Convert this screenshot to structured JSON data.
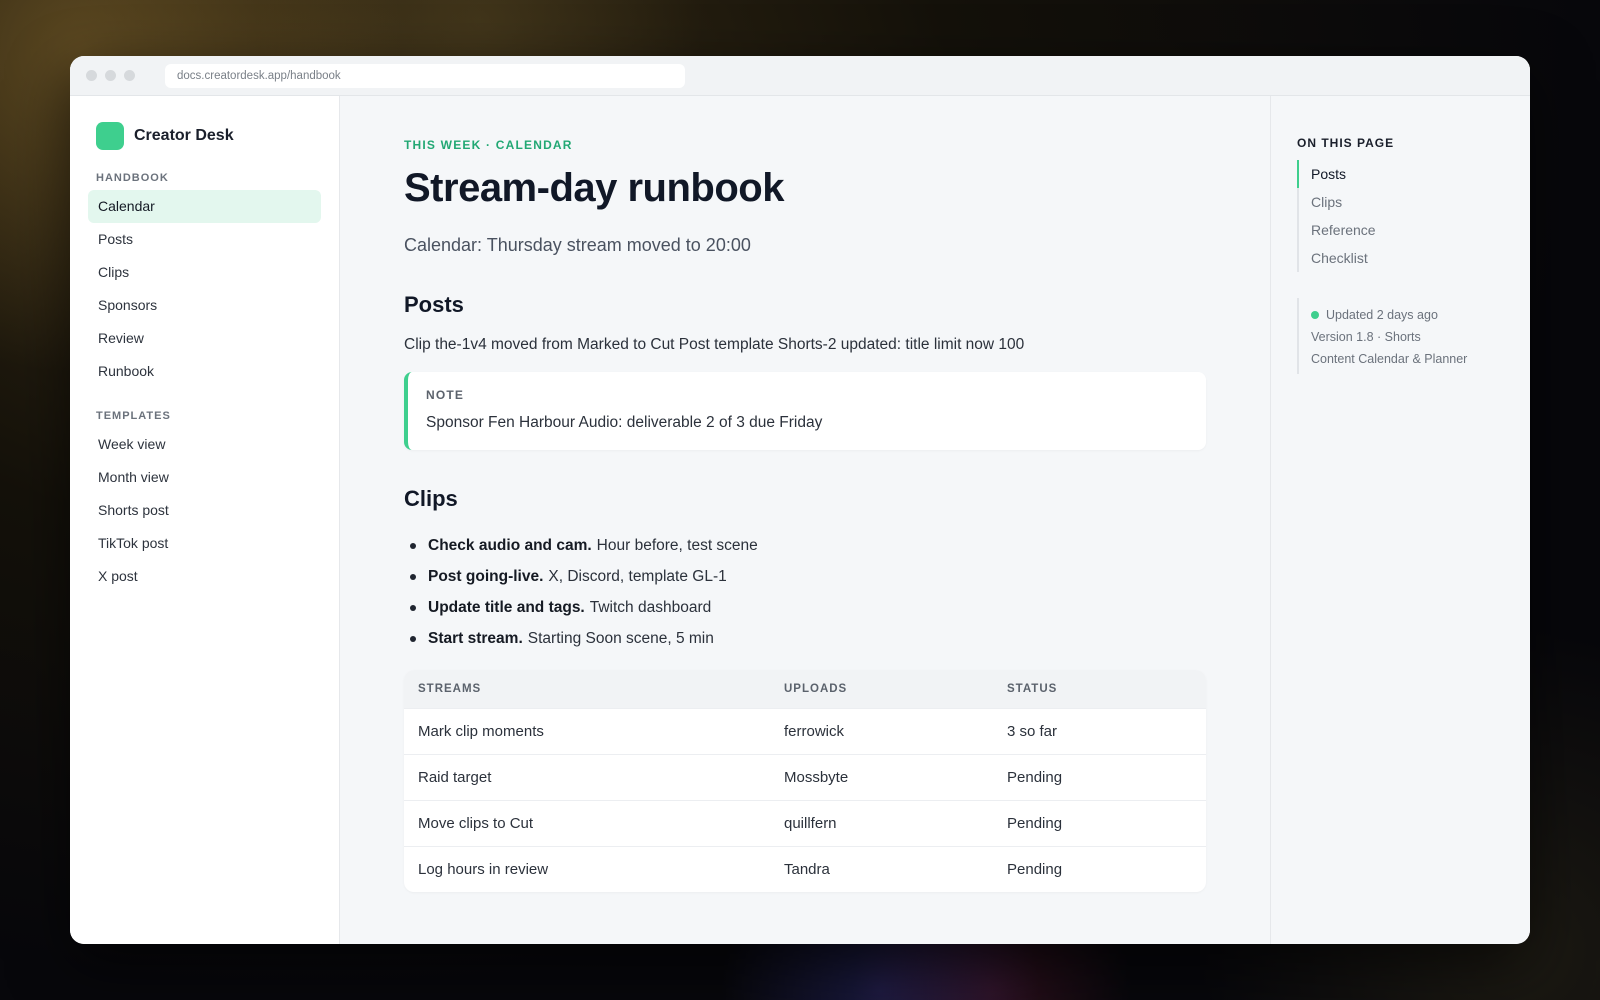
{
  "browser": {
    "url": "docs.creatordesk.app/handbook"
  },
  "brand": {
    "name": "Creator Desk",
    "accent": "#3ecf8e"
  },
  "sidebar": {
    "sections": [
      {
        "title": "HANDBOOK",
        "items": [
          {
            "label": "Calendar",
            "active": true
          },
          {
            "label": "Posts"
          },
          {
            "label": "Clips"
          },
          {
            "label": "Sponsors"
          },
          {
            "label": "Review"
          },
          {
            "label": "Runbook"
          }
        ]
      },
      {
        "title": "TEMPLATES",
        "items": [
          {
            "label": "Week view"
          },
          {
            "label": "Month view"
          },
          {
            "label": "Shorts post"
          },
          {
            "label": "TikTok post"
          },
          {
            "label": "X post"
          }
        ]
      }
    ]
  },
  "main": {
    "eyebrow": "THIS WEEK · CALENDAR",
    "title": "Stream-day runbook",
    "lede": "Calendar: Thursday stream moved to 20:00",
    "posts": {
      "heading": "Posts",
      "text": "Clip the-1v4 moved from Marked to Cut Post template Shorts-2 updated: title limit now 100",
      "note_label": "NOTE",
      "note_text": "Sponsor Fen Harbour Audio: deliverable 2 of 3 due Friday"
    },
    "clips": {
      "heading": "Clips",
      "bullets": [
        {
          "bold": "Check audio and cam.",
          "text": "Hour before, test scene"
        },
        {
          "bold": "Post going-live.",
          "text": "X, Discord, template GL-1"
        },
        {
          "bold": "Update title and tags.",
          "text": "Twitch dashboard"
        },
        {
          "bold": "Start stream.",
          "text": "Starting Soon scene, 5 min"
        }
      ]
    },
    "table": {
      "headers": [
        "STREAMS",
        "UPLOADS",
        "STATUS"
      ],
      "rows": [
        [
          "Mark clip moments",
          "ferrowick",
          "3 so far"
        ],
        [
          "Raid target",
          "Mossbyte",
          "Pending"
        ],
        [
          "Move clips to Cut",
          "quillfern",
          "Pending"
        ],
        [
          "Log hours in review",
          "Tandra",
          "Pending"
        ]
      ]
    }
  },
  "toc": {
    "title": "ON THIS PAGE",
    "items": [
      {
        "label": "Posts",
        "active": true
      },
      {
        "label": "Clips"
      },
      {
        "label": "Reference"
      },
      {
        "label": "Checklist"
      }
    ],
    "meta": {
      "updated": "Updated 2 days ago",
      "version": "Version 1.8 · Shorts",
      "product": "Content Calendar & Planner"
    }
  }
}
